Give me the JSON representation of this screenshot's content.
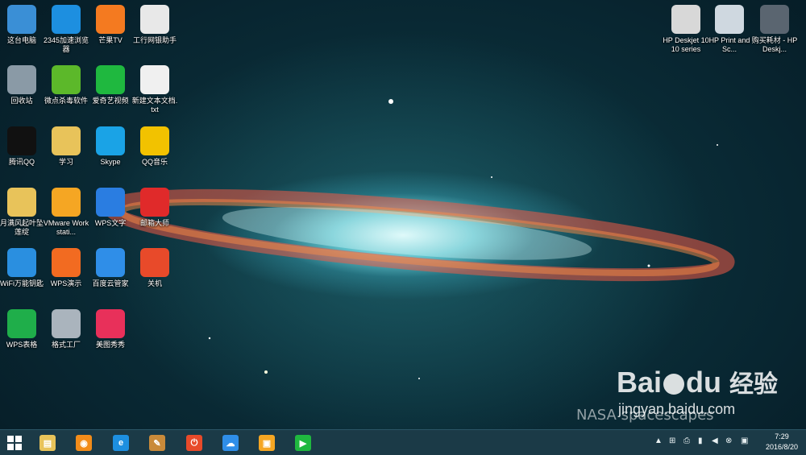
{
  "desktop_icons_left": [
    {
      "label": "这台电脑",
      "icon": "computer-icon",
      "color": "#3a8fd6"
    },
    {
      "label": "2345加速浏览器",
      "icon": "browser-icon",
      "color": "#1d8fe0"
    },
    {
      "label": "芒果TV",
      "icon": "mangotv-icon",
      "color": "#f47a20"
    },
    {
      "label": "工行网银助手",
      "icon": "icbc-icon",
      "color": "#e8e8e8"
    },
    {
      "label": "回收站",
      "icon": "recycle-bin-icon",
      "color": "#8a9aa6"
    },
    {
      "label": "微点杀毒软件",
      "icon": "antivirus-icon",
      "color": "#5cb82a"
    },
    {
      "label": "爱奇艺视频",
      "icon": "iqiyi-icon",
      "color": "#1fb83f"
    },
    {
      "label": "新建文本文档.txt",
      "icon": "text-file-icon",
      "color": "#f0f0f0"
    },
    {
      "label": "腾讯QQ",
      "icon": "qq-icon",
      "color": "#111111"
    },
    {
      "label": "学习",
      "icon": "folder-icon",
      "color": "#e8c35a"
    },
    {
      "label": "Skype",
      "icon": "skype-icon",
      "color": "#1aa3e6"
    },
    {
      "label": "QQ音乐",
      "icon": "qq-music-icon",
      "color": "#f2c200"
    },
    {
      "label": "月满风起叶坠莲绽",
      "icon": "folder-icon",
      "color": "#e8c35a"
    },
    {
      "label": "VMware Workstati...",
      "icon": "vmware-icon",
      "color": "#f5a623"
    },
    {
      "label": "WPS文字",
      "icon": "wps-writer-icon",
      "color": "#2a7de1"
    },
    {
      "label": "邮箱大师",
      "icon": "mail-master-icon",
      "color": "#e02a2a"
    },
    {
      "label": "WiFi万能钥匙",
      "icon": "wifi-key-icon",
      "color": "#2a8fe0"
    },
    {
      "label": "WPS演示",
      "icon": "wps-presentation-icon",
      "color": "#f26b21"
    },
    {
      "label": "百度云管家",
      "icon": "baidu-cloud-icon",
      "color": "#2f8ee8"
    },
    {
      "label": "关机",
      "icon": "shutdown-icon",
      "color": "#e84a2a"
    },
    {
      "label": "WPS表格",
      "icon": "wps-spreadsheet-icon",
      "color": "#1fae4a"
    },
    {
      "label": "格式工厂",
      "icon": "format-factory-icon",
      "color": "#aab4bd"
    },
    {
      "label": "美图秀秀",
      "icon": "meitu-icon",
      "color": "#e8305a"
    }
  ],
  "desktop_icons_right": [
    {
      "label": "HP Deskjet 1010 series",
      "icon": "printer-icon",
      "color": "#d8d8d8"
    },
    {
      "label": "HP Print and Sc...",
      "icon": "hp-scan-icon",
      "color": "#cfd8e0"
    },
    {
      "label": "购买耗材 - HP Deskj...",
      "icon": "hp-supplies-icon",
      "color": "#5a6570"
    }
  ],
  "watermark": {
    "brand": "Bai",
    "brand2": "du",
    "suffix": "经验",
    "url": "jingyan.baidu.com"
  },
  "wallpaper_text": "NASA spacescapes",
  "taskbar": {
    "start": "start-icon",
    "apps": [
      {
        "icon": "file-explorer-icon",
        "color": "#e8c35a",
        "glyph": "▤"
      },
      {
        "icon": "wifi-key-icon",
        "color": "#f28c1a",
        "glyph": "◉"
      },
      {
        "icon": "ie-browser-icon",
        "color": "#1d8fe0",
        "glyph": "e"
      },
      {
        "icon": "paint-icon",
        "color": "#c98a3a",
        "glyph": "✎"
      },
      {
        "icon": "shutdown-icon",
        "color": "#e84a2a",
        "glyph": "⏻"
      },
      {
        "icon": "baidu-cloud-icon",
        "color": "#2f8ee8",
        "glyph": "☁"
      },
      {
        "icon": "vmware-icon",
        "color": "#f5a623",
        "glyph": "▣"
      },
      {
        "icon": "iqiyi-icon",
        "color": "#1fb83f",
        "glyph": "▶"
      }
    ],
    "time": "7:29",
    "date": "2016/8/20"
  }
}
